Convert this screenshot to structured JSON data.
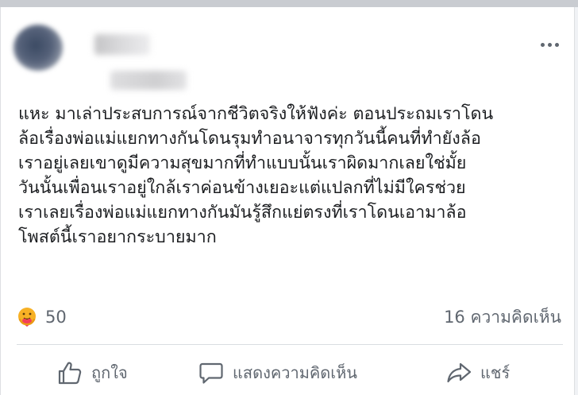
{
  "post": {
    "text_lines": [
      "แหะ มาเล่าประสบการณ์จากชีวิตจริงให้ฟังค่ะ ตอนประถมเราโดน",
      "ล้อเรื่องพ่อแม่แยกทางกันโดนรุมทำอนาจารทุกวันนี้คนที่ทำยังล้อ",
      "เราอยู่เลยเขาดูมีความสุขมากที่ทำแบบนั้นเราผิดมากเลยใช่มั้ย",
      "วันนั้นเพื่อนเราอยู่ใกล้เราค่อนข้างเยอะแต่แปลกที่ไม่มีใครช่วย",
      "เราเลยเรื่องพ่อแม่แยกทางกันมันรู้สึกแย่ตรงที่เราโดนเอามาล้อ",
      "โพสต์นี้เราอยากระบายมาก"
    ]
  },
  "reactions": {
    "icon": "care-reaction-icon",
    "count": "50"
  },
  "comments": {
    "count_label": "16 ความคิดเห็น"
  },
  "actions": {
    "like_label": "ถูกใจ",
    "comment_label": "แสดงความคิดเห็น",
    "share_label": "แชร์"
  },
  "colors": {
    "text": "#1c1e21",
    "secondary_text": "#606770",
    "background": "#ffffff",
    "care_yellow": "#f7b125",
    "care_red": "#f33e58"
  }
}
